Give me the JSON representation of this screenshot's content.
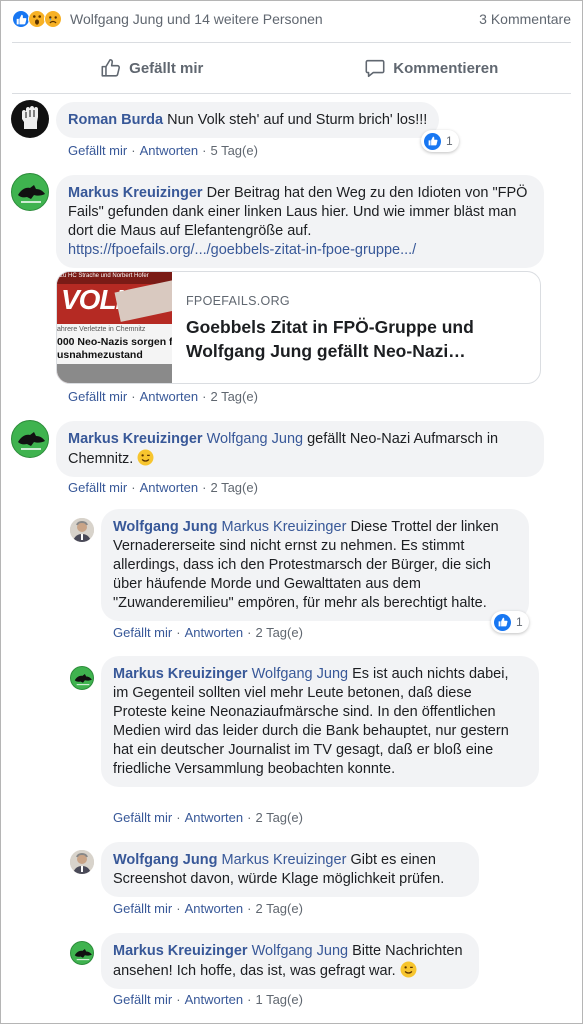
{
  "summary": {
    "reactions": [
      "like-icon",
      "wow-icon",
      "sad-icon"
    ],
    "names": "Wolfgang Jung und 14 weitere Personen",
    "comment_count": "3 Kommentare"
  },
  "actions": {
    "like": "Gefällt mir",
    "comment": "Kommentieren"
  },
  "labels": {
    "like": "Gefällt mir",
    "reply": "Antworten",
    "dot": "·"
  },
  "colors": {
    "link": "#385898",
    "bubble": "#f2f3f5",
    "like_blue": "#1877f2"
  },
  "comments": [
    {
      "author": "Roman Burda",
      "text": "Nun Volk steh' auf und Sturm brich' los!!!",
      "time": "5 Tag(e)",
      "reactions": "1"
    },
    {
      "author": "Markus Kreuizinger",
      "text": "Der Beitrag hat den Weg zu den Idioten von \"FPÖ Fails\" gefunden dank einer linken Laus hier. Und wie immer bläst man dort die Maus auf Elefantengröße auf.",
      "link": "https://fpoefails.org/.../goebbels-zitat-in-fpoe-gruppe.../",
      "card": {
        "image_text_top": "zu HC Strache und Norbert Hofer",
        "image_text_big": "VOLK",
        "image_text_line1": "ahrere Verletzte in Chemnitz",
        "image_text_line2": "000 Neo-Nazis sorgen f",
        "image_text_line3": "usnahmezustand",
        "domain": "FPOEFAILS.ORG",
        "title": "Goebbels Zitat in FPÖ-Gruppe und Wolfgang Jung gefällt Neo-Nazi…"
      },
      "time": "2 Tag(e)"
    },
    {
      "author": "Markus Kreuizinger",
      "mention": "Wolfgang Jung",
      "text": "gefällt Neo-Nazi Aufmarsch in Chemnitz.",
      "time": "2 Tag(e)"
    }
  ],
  "replies": [
    {
      "author": "Wolfgang Jung",
      "mention": "Markus Kreuizinger",
      "text": "Diese Trottel der linken Vernadererseite sind nicht ernst zu nehmen. Es stimmt allerdings, dass ich den Protestmarsch der Bürger, die sich über häufende Morde und Gewalttaten aus dem \"Zuwanderemilieu\" empören, für mehr als berechtigt halte.",
      "time": "2 Tag(e)",
      "reactions": "1"
    },
    {
      "author": "Markus Kreuizinger",
      "mention": "Wolfgang Jung",
      "text": "Es ist auch nichts dabei, im Gegenteil sollten viel mehr Leute betonen, daß diese Proteste keine Neonaziaufmärsche sind. In den öffentlichen Medien wird das leider durch die Bank behauptet, nur gestern hat ein deutscher Journalist im TV gesagt, daß er bloß eine friedliche Versammlung beobachten konnte.",
      "time": "2 Tag(e)"
    },
    {
      "author": "Wolfgang Jung",
      "mention": "Markus Kreuizinger",
      "text": "Gibt es einen Screenshot davon, würde Klage möglichkeit prüfen.",
      "time": "2 Tag(e)"
    },
    {
      "author": "Markus Kreuizinger",
      "mention": "Wolfgang Jung",
      "text": "Bitte Nachrichten ansehen! Ich hoffe, das ist, was gefragt war.",
      "time": "1 Tag(e)"
    }
  ]
}
